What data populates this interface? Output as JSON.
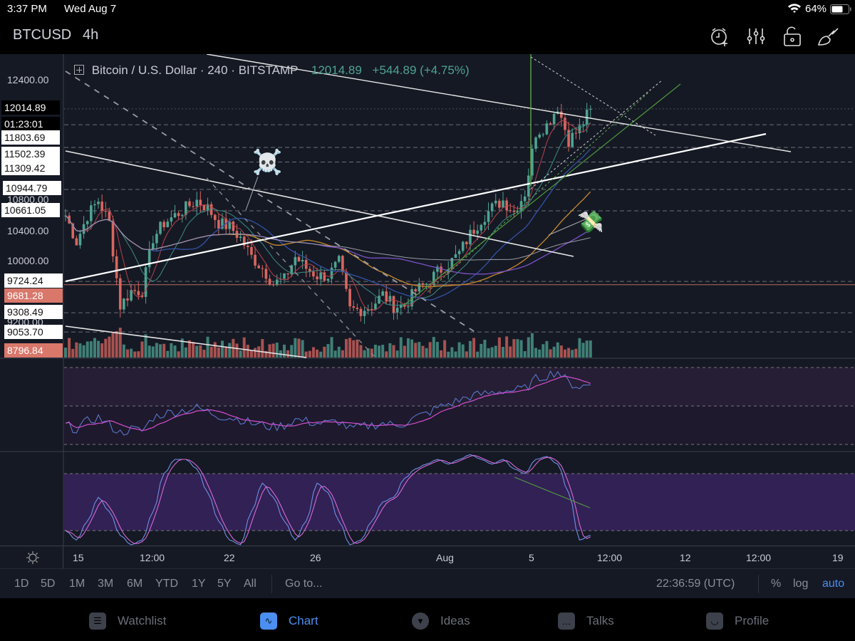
{
  "status_bar": {
    "time": "3:37 PM",
    "date": "Wed Aug 7",
    "battery": "64%"
  },
  "header": {
    "symbol": "BTCUSD",
    "interval": "4h",
    "icons": [
      "alarm-add-icon",
      "indicators-sliders-icon",
      "lock-open-icon",
      "drawing-brush-icon"
    ]
  },
  "legend": {
    "name": "Bitcoin / U.S. Dollar · 240 · BITSTAMP",
    "price": "12014.89",
    "change": "+544.89 (+4.75%)"
  },
  "price_axis": {
    "ticks": [
      "12400.00",
      "10800.00",
      "10400.00",
      "10000.00",
      "9200.00"
    ],
    "current_price": "12014.89",
    "countdown": "01:23:01",
    "levels": [
      "11803.69",
      "11502.39",
      "11309.42",
      "10944.79",
      "10661.05",
      "9724.24",
      "9308.49",
      "9053.70"
    ],
    "red_levels": [
      "9681.28",
      "8796.84"
    ]
  },
  "time_axis": {
    "ticks": [
      "15",
      "12:00",
      "22",
      "26",
      "Aug",
      "5",
      "12:00",
      "12",
      "12:00",
      "19"
    ]
  },
  "range_bar": {
    "ranges": [
      "1D",
      "5D",
      "1M",
      "3M",
      "6M",
      "YTD",
      "1Y",
      "5Y",
      "All"
    ],
    "goto": "Go to...",
    "clock": "22:36:59 (UTC)",
    "percent": "%",
    "log": "log",
    "auto": "auto"
  },
  "tabs": [
    {
      "label": "Watchlist",
      "icon": "list-icon"
    },
    {
      "label": "Chart",
      "icon": "chart-icon",
      "active": true
    },
    {
      "label": "Ideas",
      "icon": "lightbulb-icon"
    },
    {
      "label": "Talks",
      "icon": "chat-icon"
    },
    {
      "label": "Profile",
      "icon": "smiley-icon"
    }
  ],
  "annotations": {
    "skull": "☠️",
    "money": "💸"
  },
  "colors": {
    "up": "#4fa391",
    "down": "#d9665f",
    "background": "#151924",
    "accent": "#4b8ff0"
  },
  "chart_data": {
    "type": "candlestick",
    "symbol": "BTCUSD",
    "interval": "4h",
    "closes_12h": [
      10600,
      10250,
      10600,
      10800,
      10500,
      9400,
      9600,
      9600,
      10300,
      10500,
      10600,
      10700,
      10800,
      10700,
      10500,
      10450,
      10300,
      10050,
      9900,
      9700,
      9750,
      10050,
      9900,
      9800,
      9800,
      9980,
      9350,
      9350,
      9400,
      9550,
      9400,
      9400,
      9600,
      9700,
      9850,
      9950,
      10100,
      10350,
      10550,
      10700,
      10800,
      10650,
      10900,
      11700,
      11800,
      12050,
      11600,
      11750,
      12014.89
    ],
    "rsi_12h": [
      40,
      38,
      42,
      44,
      40,
      36,
      38,
      37,
      44,
      46,
      47,
      48,
      49,
      47,
      45,
      44,
      43,
      41,
      40,
      39,
      40,
      43,
      42,
      41,
      41,
      42,
      38,
      39,
      40,
      41,
      40,
      41,
      44,
      46,
      49,
      51,
      53,
      55,
      56,
      57,
      58,
      58,
      59,
      64,
      66,
      68,
      62,
      60,
      61
    ],
    "stoch_12h": [
      20,
      10,
      30,
      55,
      40,
      15,
      5,
      10,
      40,
      80,
      95,
      95,
      85,
      60,
      30,
      10,
      5,
      40,
      70,
      55,
      30,
      10,
      30,
      70,
      60,
      30,
      5,
      10,
      30,
      50,
      55,
      75,
      85,
      90,
      95,
      90,
      95,
      100,
      95,
      90,
      95,
      85,
      80,
      95,
      98,
      90,
      60,
      10,
      15
    ],
    "horizontal_levels": [
      11803.69,
      11502.39,
      11309.42,
      10944.79,
      10661.05,
      9724.24,
      9681.28,
      9308.49,
      9053.7
    ],
    "y_range": [
      8700,
      12550
    ]
  }
}
